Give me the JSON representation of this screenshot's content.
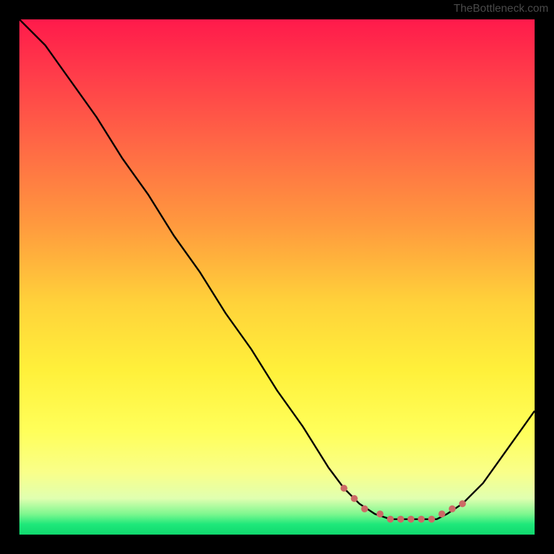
{
  "attribution": "TheBottleneck.com",
  "chart_data": {
    "type": "line",
    "title": "",
    "xlabel": "",
    "ylabel": "",
    "xlim": [
      0,
      1
    ],
    "ylim": [
      0,
      1
    ],
    "x": [
      0.0,
      0.05,
      0.1,
      0.15,
      0.2,
      0.25,
      0.3,
      0.35,
      0.4,
      0.45,
      0.5,
      0.55,
      0.6,
      0.63,
      0.66,
      0.69,
      0.72,
      0.75,
      0.78,
      0.81,
      0.83,
      0.86,
      0.9,
      0.95,
      1.0
    ],
    "y": [
      1.0,
      0.95,
      0.88,
      0.81,
      0.73,
      0.66,
      0.58,
      0.51,
      0.43,
      0.36,
      0.28,
      0.21,
      0.13,
      0.09,
      0.06,
      0.04,
      0.03,
      0.03,
      0.03,
      0.03,
      0.04,
      0.06,
      0.1,
      0.17,
      0.24
    ],
    "marker_color": "#cc6a66",
    "marker_radius_px": 5,
    "markers_x": [
      0.63,
      0.65,
      0.67,
      0.7,
      0.72,
      0.74,
      0.76,
      0.78,
      0.8,
      0.82,
      0.84,
      0.86
    ],
    "markers_y": [
      0.09,
      0.07,
      0.05,
      0.04,
      0.03,
      0.03,
      0.03,
      0.03,
      0.03,
      0.04,
      0.05,
      0.06
    ]
  }
}
